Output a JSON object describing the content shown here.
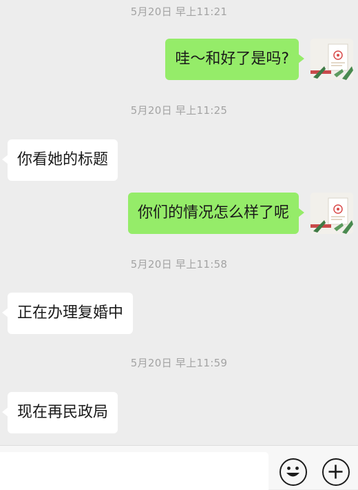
{
  "messages": [
    {
      "type": "timestamp",
      "text": "5月20日 早上11:21"
    },
    {
      "type": "sent",
      "text": "哇～和好了是吗?",
      "avatar": "gift-card-avatar"
    },
    {
      "type": "timestamp",
      "text": "5月20日 早上11:25"
    },
    {
      "type": "received",
      "text": "你看她的标题"
    },
    {
      "type": "sent",
      "text": "你们的情况怎么样了呢",
      "avatar": "gift-card-avatar"
    },
    {
      "type": "timestamp",
      "text": "5月20日 早上11:58"
    },
    {
      "type": "received",
      "text": "正在办理复婚中"
    },
    {
      "type": "timestamp",
      "text": "5月20日 早上11:59"
    },
    {
      "type": "received",
      "text": "现在再民政局"
    }
  ],
  "input_bar": {
    "value": "",
    "icons": [
      "emoji-icon",
      "plus-icon"
    ]
  },
  "colors": {
    "background": "#ededed",
    "sent_bubble": "#95ec69",
    "received_bubble": "#ffffff",
    "timestamp": "#a3a3a3"
  }
}
